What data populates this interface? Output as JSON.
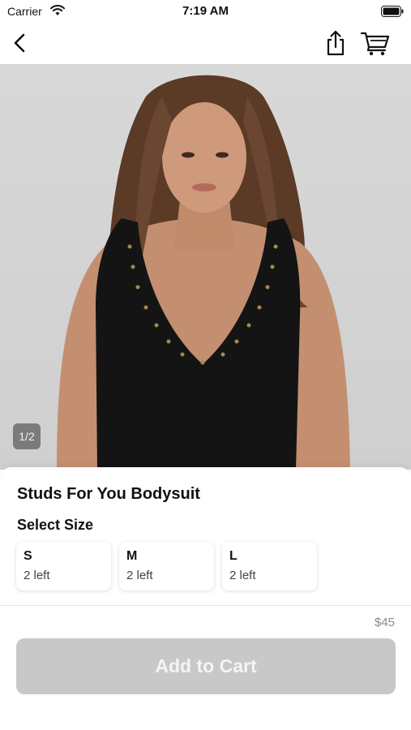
{
  "status_bar": {
    "carrier": "Carrier",
    "time": "7:19 AM"
  },
  "nav": {
    "back_icon": "chevron-left-icon",
    "share_icon": "share-icon",
    "cart_icon": "cart-icon"
  },
  "gallery": {
    "page_indicator": "1/2"
  },
  "product": {
    "title": "Studs For You Bodysuit",
    "size_heading": "Select Size",
    "sizes": [
      {
        "code": "S",
        "stock": "2 left"
      },
      {
        "code": "M",
        "stock": "2 left"
      },
      {
        "code": "L",
        "stock": "2 left"
      }
    ],
    "price": "$45"
  },
  "actions": {
    "add_to_cart_label": "Add to Cart"
  },
  "colors": {
    "button_disabled": "#c8c8c8",
    "accent_text": "#111111",
    "price_text": "#8a8a8a"
  }
}
